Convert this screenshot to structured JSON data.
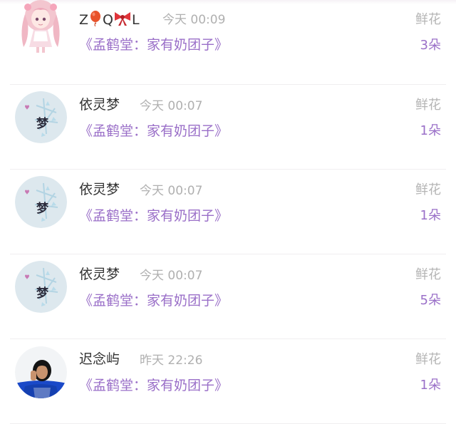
{
  "entries": [
    {
      "user": "Z🎈Q🎀L",
      "name_parts": [
        "Z",
        "Q",
        "L"
      ],
      "time": "今天 00:09",
      "book": "《孟鹤堂：家有奶团子》",
      "gift": "鲜花",
      "count": "3朵",
      "avatar": "anime-girl-avatar"
    },
    {
      "user": "依灵梦",
      "time": "今天 00:07",
      "book": "《孟鹤堂：家有奶团子》",
      "gift": "鲜花",
      "count": "1朵",
      "avatar": "meng-character-avatar"
    },
    {
      "user": "依灵梦",
      "time": "今天 00:07",
      "book": "《孟鹤堂：家有奶团子》",
      "gift": "鲜花",
      "count": "1朵",
      "avatar": "meng-character-avatar"
    },
    {
      "user": "依灵梦",
      "time": "今天 00:07",
      "book": "《孟鹤堂：家有奶团子》",
      "gift": "鲜花",
      "count": "5朵",
      "avatar": "meng-character-avatar"
    },
    {
      "user": "迟念屿",
      "time": "昨天 22:26",
      "book": "《孟鹤堂：家有奶团子》",
      "gift": "鲜花",
      "count": "1朵",
      "avatar": "photo-person-avatar"
    }
  ],
  "colors": {
    "accent": "#9a6fc8",
    "muted": "#b0b0b0",
    "name": "#333333"
  }
}
